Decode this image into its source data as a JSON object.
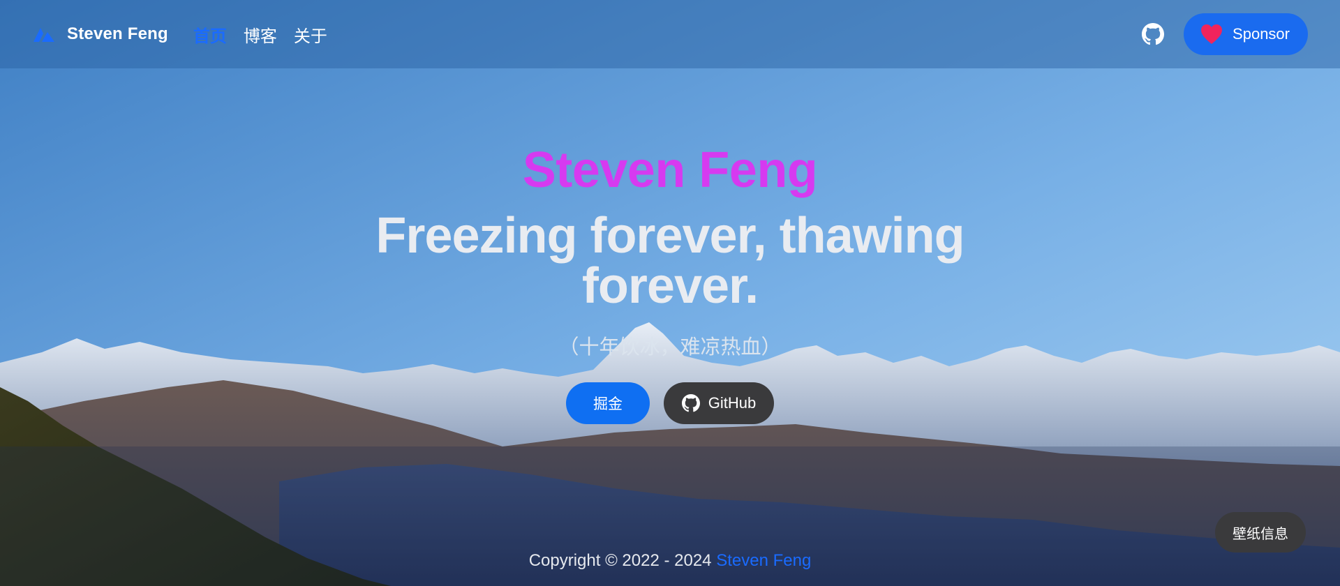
{
  "navbar": {
    "brand_name": "Steven Feng",
    "links": [
      {
        "label": "首页",
        "active": true
      },
      {
        "label": "博客",
        "active": false
      },
      {
        "label": "关于",
        "active": false
      }
    ],
    "github_icon": "github-icon",
    "sponsor_label": "Sponsor",
    "sponsor_icon": "heart-icon"
  },
  "hero": {
    "name": "Steven Feng",
    "tagline": "Freezing forever, thawing forever.",
    "subtitle": "（十年饮冰，难凉热血）",
    "primary_button": "掘金",
    "github_button": "GitHub"
  },
  "footer": {
    "copyright": "Copyright © 2022 - 2024 ",
    "author": "Steven Feng"
  },
  "wallpaper_button": "壁纸信息",
  "colors": {
    "accent": "#1a6bff",
    "name_color": "#d63af0",
    "dark_button": "#3a3a3c",
    "sky_top": "#4a86c8",
    "sky_bottom": "#9cc8ee"
  }
}
